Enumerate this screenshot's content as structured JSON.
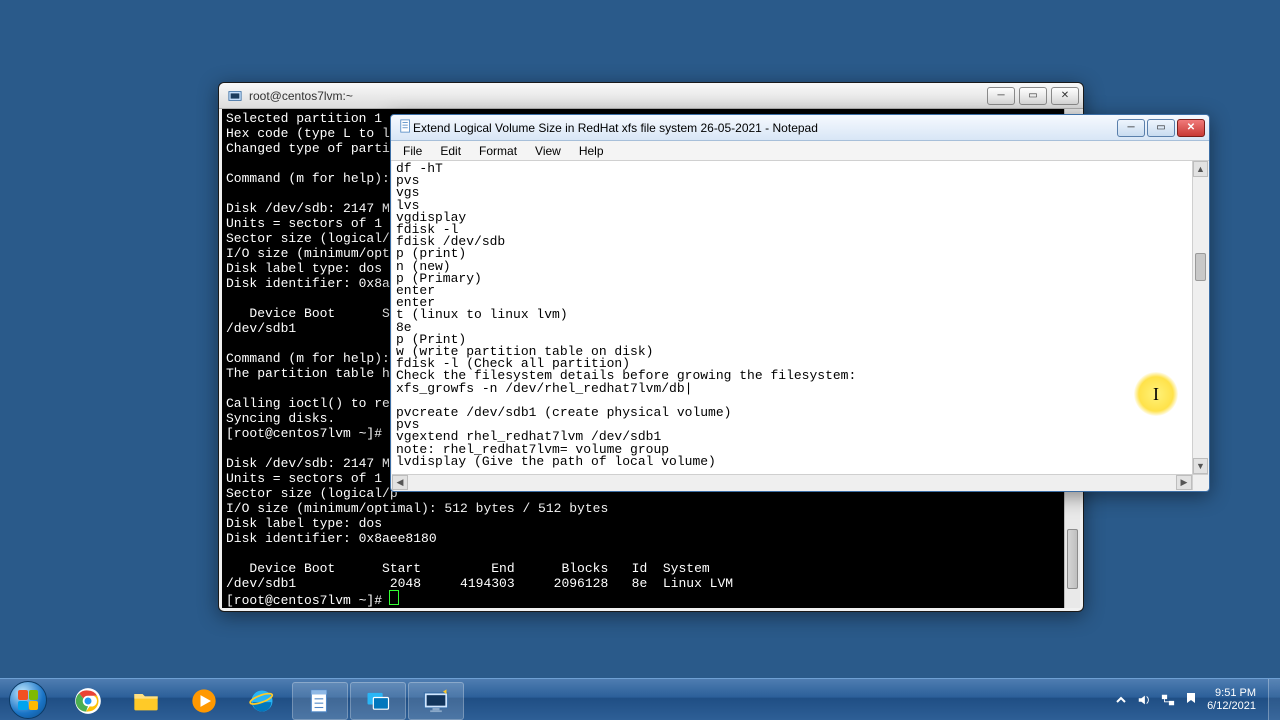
{
  "terminal": {
    "title": "root@centos7lvm:~",
    "body": "Selected partition 1\nHex code (type L to li\nChanged type of partit\n\nCommand (m for help): \n\nDisk /dev/sdb: 2147 M\nUnits = sectors of 1 *\nSector size (logical/p\nI/O size (minimum/opt\nDisk label type: dos\nDisk identifier: 0x8ae\n\n   Device Boot      St\n/dev/sdb1\n\nCommand (m for help): \nThe partition table ha\n\nCalling ioctl() to re-\nSyncing disks.\n[root@centos7lvm ~]# f\n\nDisk /dev/sdb: 2147 M\nUnits = sectors of 1 *\nSector size (logical/p\nI/O size (minimum/optimal): 512 bytes / 512 bytes\nDisk label type: dos\nDisk identifier: 0x8aee8180\n\n   Device Boot      Start         End      Blocks   Id  System\n/dev/sdb1            2048     4194303     2096128   8e  Linux LVM\n[root@centos7lvm ~]# "
  },
  "notepad": {
    "title": "Extend Logical Volume Size in RedHat xfs file system 26-05-2021 - Notepad",
    "menu": {
      "file": "File",
      "edit": "Edit",
      "format": "Format",
      "view": "View",
      "help": "Help"
    },
    "body": "df -hT\npvs\nvgs\nlvs\nvgdisplay\nfdisk -l\nfdisk /dev/sdb\np (print)\nn (new)\np (Primary)\nenter\nenter\nt (linux to linux lvm)\n8e\np (Print)\nw (write partition table on disk)\nfdisk -l (Check all partition)\nCheck the filesystem details before growing the filesystem:\nxfs_growfs -n /dev/rhel_redhat7lvm/db|\n\npvcreate /dev/sdb1 (create physical volume)\npvs\nvgextend rhel_redhat7lvm /dev/sdb1\nnote: rhel_redhat7lvm= volume group\nlvdisplay (Give the path of local volume)"
  },
  "taskbar": {
    "time": "9:51 PM",
    "date": "6/12/2021"
  }
}
